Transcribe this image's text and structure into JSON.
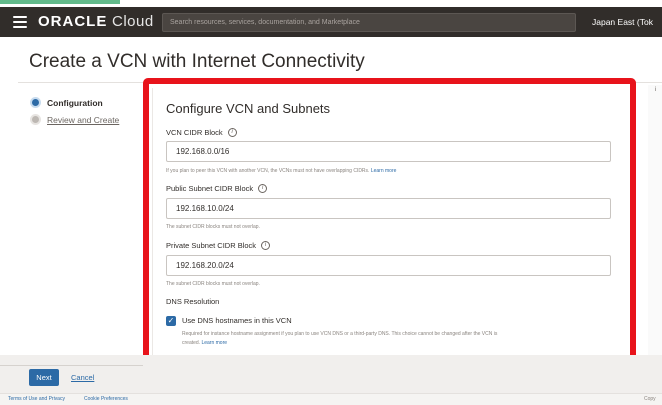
{
  "header": {
    "logo_brand": "ORACLE",
    "logo_product": "Cloud",
    "search_placeholder": "Search resources, services, documentation, and Marketplace",
    "region": "Japan East (Tok"
  },
  "page": {
    "title": "Create a VCN with Internet Connectivity"
  },
  "steps": [
    {
      "label": "Configuration",
      "state": "current"
    },
    {
      "label": "Review and Create",
      "state": "pending"
    }
  ],
  "form": {
    "section_title": "Configure VCN and Subnets",
    "vcn_cidr": {
      "label": "VCN CIDR Block",
      "value": "192.168.0.0/16",
      "helper": "If you plan to peer this VCN with another VCN, the VCNs must not have overlapping CIDRs.",
      "helper_link": "Learn more"
    },
    "public_subnet_cidr": {
      "label": "Public Subnet CIDR Block",
      "value": "192.168.10.0/24",
      "helper": "The subnet CIDR blocks must not overlap."
    },
    "private_subnet_cidr": {
      "label": "Private Subnet CIDR Block",
      "value": "192.168.20.0/24",
      "helper": "The subnet CIDR blocks must not overlap."
    },
    "dns": {
      "section_label": "DNS Resolution",
      "checkbox_label": "Use DNS hostnames in this VCN",
      "checked": true,
      "helper_line1": "Required for instance hostname assignment if you plan to use VCN DNS or a third-party DNS. This choice cannot be changed after the VCN is",
      "helper_line2": "created.",
      "helper_link": "Learn more"
    }
  },
  "footer": {
    "next_label": "Next",
    "cancel_label": "Cancel",
    "terms_label": "Terms of Use and Privacy",
    "cookie_label": "Cookie Preferences",
    "right_text": "Copy"
  },
  "colors": {
    "header_bg": "#312d2a",
    "accent": "#2c6aa6",
    "highlight": "#e8131b"
  }
}
